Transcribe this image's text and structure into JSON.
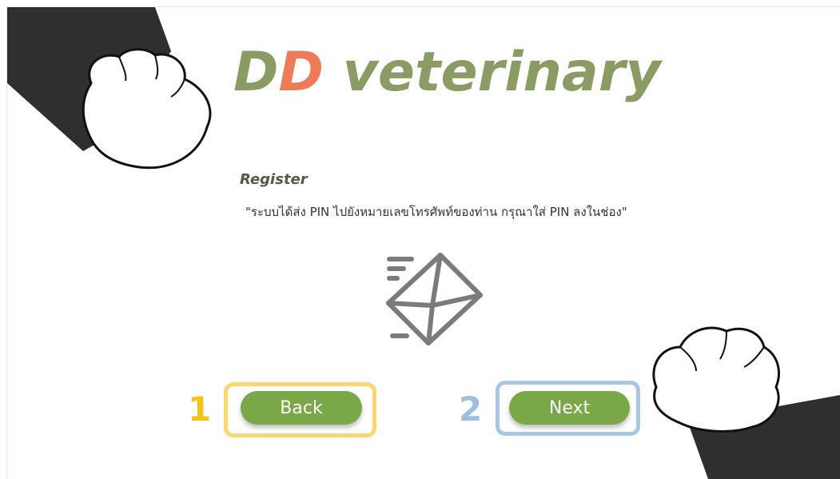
{
  "brand": {
    "part1": "D",
    "part2": "D",
    "part3": " veterinary"
  },
  "register": {
    "title": "Register",
    "instruction": "\"ระบบได้ส่ง PIN ไปยังหมายเลขโทรศัพท์ของท่าน กรุณาใส่ PIN ลงในช่อง\""
  },
  "icons": {
    "mail": "email-sent-icon",
    "paws": "paw-icon"
  },
  "annotations": {
    "back_number": "1",
    "next_number": "2"
  },
  "buttons": {
    "back_label": "Back",
    "next_label": "Next"
  },
  "colors": {
    "brand_green": "#8a9b63",
    "brand_orange": "#ee7b57",
    "button_green": "#7aa847",
    "highlight_yellow": "#fcd671",
    "highlight_blue": "#a9c6e4"
  }
}
